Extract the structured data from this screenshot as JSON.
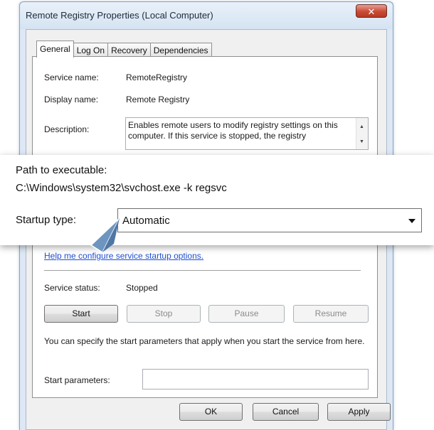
{
  "window": {
    "title": "Remote Registry Properties (Local Computer)",
    "close_glyph": "✕"
  },
  "tabs": [
    {
      "label": "General",
      "active": true
    },
    {
      "label": "Log On",
      "active": false
    },
    {
      "label": "Recovery",
      "active": false
    },
    {
      "label": "Dependencies",
      "active": false
    }
  ],
  "general": {
    "service_name_label": "Service name:",
    "service_name": "RemoteRegistry",
    "display_name_label": "Display name:",
    "display_name": "Remote Registry",
    "description_label": "Description:",
    "description": "Enables remote users to modify registry settings on this computer. If this service is stopped, the registry",
    "help_link": "Help me configure service startup options.",
    "service_status_label": "Service status:",
    "service_status": "Stopped",
    "buttons": {
      "start": "Start",
      "stop": "Stop",
      "pause": "Pause",
      "resume": "Resume"
    },
    "start_params_note": "You can specify the start parameters that apply when you start the service from here.",
    "start_params_label": "Start parameters:",
    "start_params_value": ""
  },
  "callout": {
    "path_label": "Path to executable:",
    "path_value": "C:\\Windows\\system32\\svchost.exe -k regsvc",
    "startup_type_label": "Startup type:",
    "startup_type_value": "Automatic"
  },
  "footer": {
    "ok": "OK",
    "cancel": "Cancel",
    "apply": "Apply"
  },
  "icons": {
    "close": "close-icon",
    "scroll_up": "scroll-up-icon",
    "scroll_down": "scroll-down-icon",
    "dropdown": "chevron-down-icon",
    "pointer": "callout-pointer-arrow"
  },
  "colors": {
    "frame": "#dde8f4",
    "close_button": "#c94a34",
    "link": "#1f4fd0",
    "callout_arrow": "#6d95c0"
  }
}
